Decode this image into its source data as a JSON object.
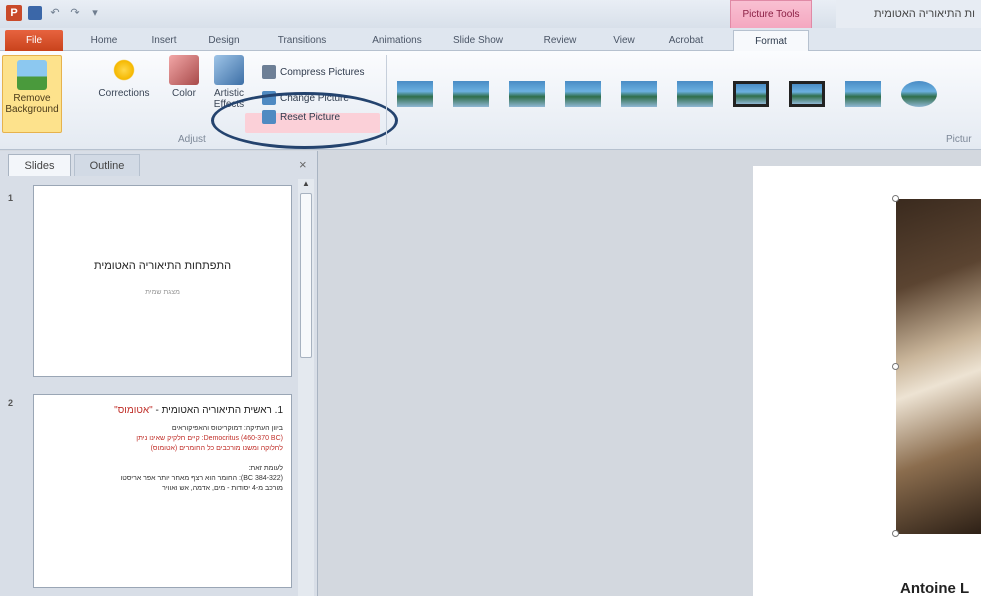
{
  "title_bar": {
    "app_letter": "P",
    "context_group": "Picture Tools",
    "window_title": "ות התיאוריה האטומית"
  },
  "tabs": [
    "File",
    "Home",
    "Insert",
    "Design",
    "Transitions",
    "Animations",
    "Slide Show",
    "Review",
    "View",
    "Acrobat",
    "Format"
  ],
  "ribbon": {
    "remove_background": "Remove Background",
    "corrections": "Corrections",
    "color": "Color",
    "artistic_effects": "Artistic Effects",
    "compress_pictures": "Compress Pictures",
    "change_picture": "Change Picture",
    "reset_picture": "Reset Picture",
    "adjust_group": "Adjust",
    "picture_styles_group": "Pictur"
  },
  "pane": {
    "tab_slides": "Slides",
    "tab_outline": "Outline",
    "close": "×",
    "slide1": {
      "number": "1",
      "title": "התפתחות התיאוריה האטומית",
      "subtitle": "מצגת שמית"
    },
    "slide2": {
      "number": "2",
      "title_prefix": "1. ראשית התיאוריה האטומית - ",
      "title_red": "\"אטומוס\"",
      "lines": [
        {
          "text": "ביוון העתיקה: דמוקריטוס והאפיקוראים",
          "red": false
        },
        {
          "text": "Democritus (460-370 BC): קיים חלקיק שאינו ניתן",
          "red": true
        },
        {
          "text": "לחלוקה ומשנו מורכבים כל החומרים (אטומוס)",
          "red": true
        },
        {
          "text": "",
          "red": false
        },
        {
          "text": "לעומת זאת:",
          "red": false
        },
        {
          "text": "(384-322 BC): החומר הוא רצף מאחר יותר אפר אריסטו",
          "red": false
        },
        {
          "text": "מורכב מ-4 יסודות - מים, אדמה, אש ואוויר",
          "red": false
        }
      ]
    }
  },
  "main": {
    "caption": "Antoine L"
  }
}
